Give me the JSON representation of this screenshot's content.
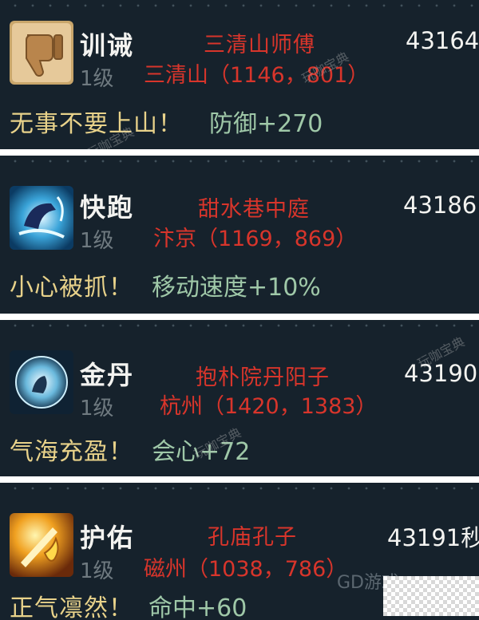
{
  "entries": [
    {
      "icon": "thumbs-down-icon",
      "name": "训诫",
      "level": "1级",
      "npc": "三清山师傅",
      "location": "三清山（1146，801）",
      "time": "43164",
      "motto": "无事不要上山！",
      "bonus": "防御+270"
    },
    {
      "icon": "running-boot-icon",
      "name": "快跑",
      "level": "1级",
      "npc": "甜水巷中庭",
      "location": "汴京（1169，869）",
      "time": "43186",
      "motto": "小心被抓！",
      "bonus": "移动速度+10%"
    },
    {
      "icon": "elixir-orb-icon",
      "name": "金丹",
      "level": "1级",
      "npc": "抱朴院丹阳子",
      "location": "杭州（1420，1383）",
      "time": "43190",
      "motto": "气海充盈！",
      "bonus": "会心+72"
    },
    {
      "icon": "shield-flame-icon",
      "name": "护佑",
      "level": "1级",
      "npc": "孔庙孔子",
      "location": "磁州（1038，786）",
      "time": "43191秒",
      "motto": "正气凛然！",
      "bonus": "命中+60"
    }
  ],
  "watermark": "玩咖宝典",
  "corner_logo": "GD游戏",
  "colors": {
    "card_bg": "#16222c",
    "npc_red": "#d8352b",
    "motto_yellow": "#e8d28a",
    "bonus_green": "#9fc8a8"
  }
}
